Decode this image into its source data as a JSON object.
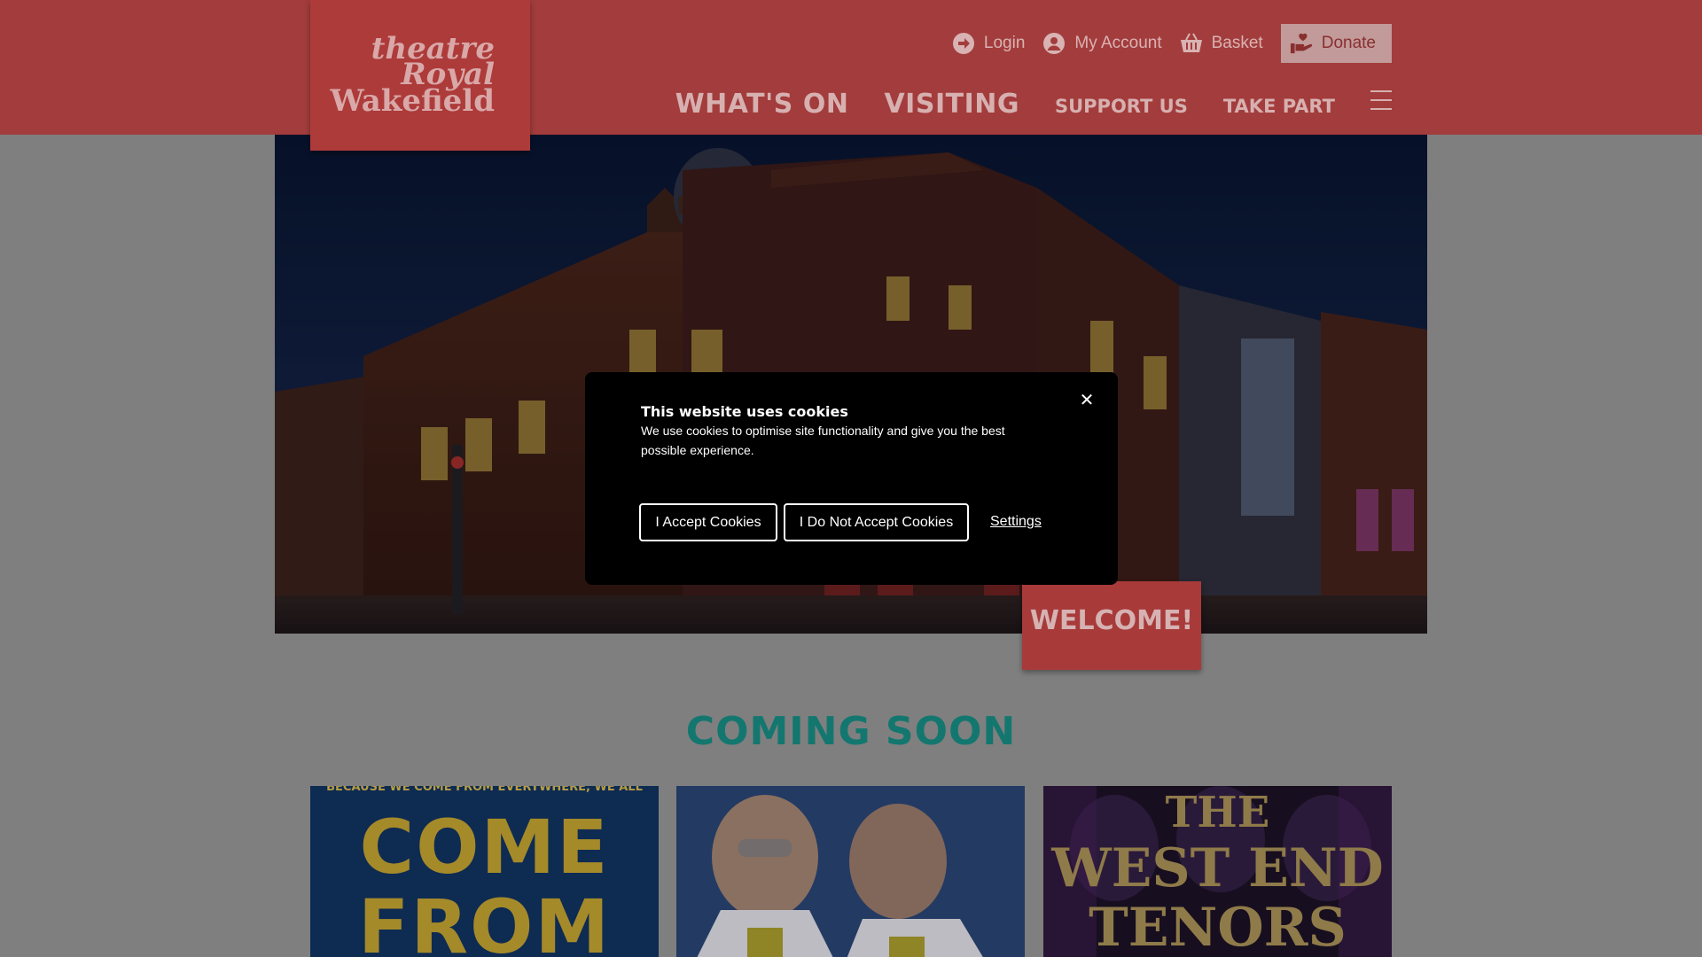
{
  "header": {
    "logo": {
      "line1": "theatre",
      "line2": "Royal",
      "line3": "Wakefield"
    },
    "util_nav": {
      "login": "Login",
      "my_account": "My Account",
      "basket": "Basket",
      "donate": "Donate"
    },
    "main_nav": [
      "WHAT'S ON",
      "VISITING",
      "SUPPORT US",
      "TAKE PART"
    ]
  },
  "hero": {
    "welcome": "WELCOME!"
  },
  "coming_soon": {
    "title": "COMING SOON",
    "cards": [
      {
        "tagline": "BECAUSE WE COME FROM EVERYWHERE, WE ALL",
        "line1": "COME",
        "line2": "FROM"
      },
      {},
      {
        "line1": "THE",
        "line2": "WEST END",
        "line3": "TENORS"
      }
    ]
  },
  "cookie": {
    "title": "This website uses cookies",
    "body": "We use cookies to optimise site functionality and give you the best possible experience.",
    "close": "✕",
    "accept": "I Accept Cookies",
    "decline": "I Do Not Accept Cookies",
    "settings": "Settings"
  },
  "colors": {
    "header": "#a33c3c",
    "coming_soon": "#13776f",
    "overlay": "#7f7f7f"
  }
}
